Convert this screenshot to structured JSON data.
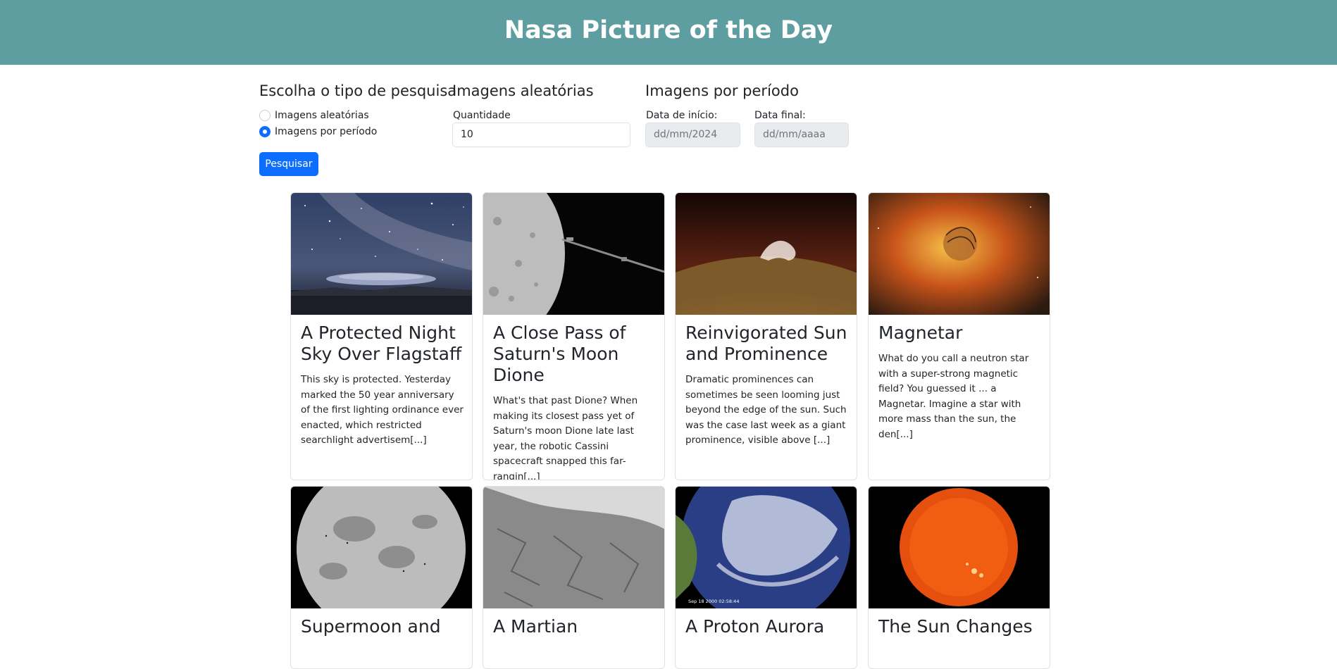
{
  "header": {
    "title": "Nasa Picture of the Day"
  },
  "search_type": {
    "heading": "Escolha o tipo de pesquisa",
    "options": [
      {
        "label": "Imagens aleatórias",
        "checked": false
      },
      {
        "label": "Imagens por período",
        "checked": true
      }
    ]
  },
  "random": {
    "heading": "Imagens aleatórias",
    "quantity_label": "Quantidade",
    "quantity_value": "10"
  },
  "period": {
    "heading": "Imagens por período",
    "start_label": "Data de início:",
    "start_value": "dd/mm/2024",
    "end_label": "Data final:",
    "end_value": "dd/mm/aaaa"
  },
  "search_button": "Pesquisar",
  "cards": [
    {
      "title": "A Protected Night Sky Over Flagstaff",
      "text": "This sky is protected. Yesterday marked the 50 year anniversary of the first lighting ordinance ever enacted, which restricted searchlight advertisem[...]"
    },
    {
      "title": "A Close Pass of Saturn's Moon Dione",
      "text": "What's that past Dione? When making its closest pass yet of Saturn's moon Dione late last year, the robotic Cassini spacecraft snapped this far-rangin[...]"
    },
    {
      "title": "Reinvigorated Sun and Prominence",
      "text": "Dramatic prominences can sometimes be seen looming just beyond the edge of the sun. Such was the case last week as a giant prominence, visible above [...]"
    },
    {
      "title": "Magnetar",
      "text": "What do you call a neutron star with a super-strong magnetic field? You guessed it ... a Magnetar. Imagine a star with more mass than the sun, the den[...]"
    },
    {
      "title": "Supermoon and",
      "text": ""
    },
    {
      "title": "A Martian",
      "text": ""
    },
    {
      "title": "A Proton Aurora",
      "text": ""
    },
    {
      "title": "The Sun Changes",
      "text": ""
    }
  ],
  "image_stamp": "Sep 18 2000   02:58:44"
}
